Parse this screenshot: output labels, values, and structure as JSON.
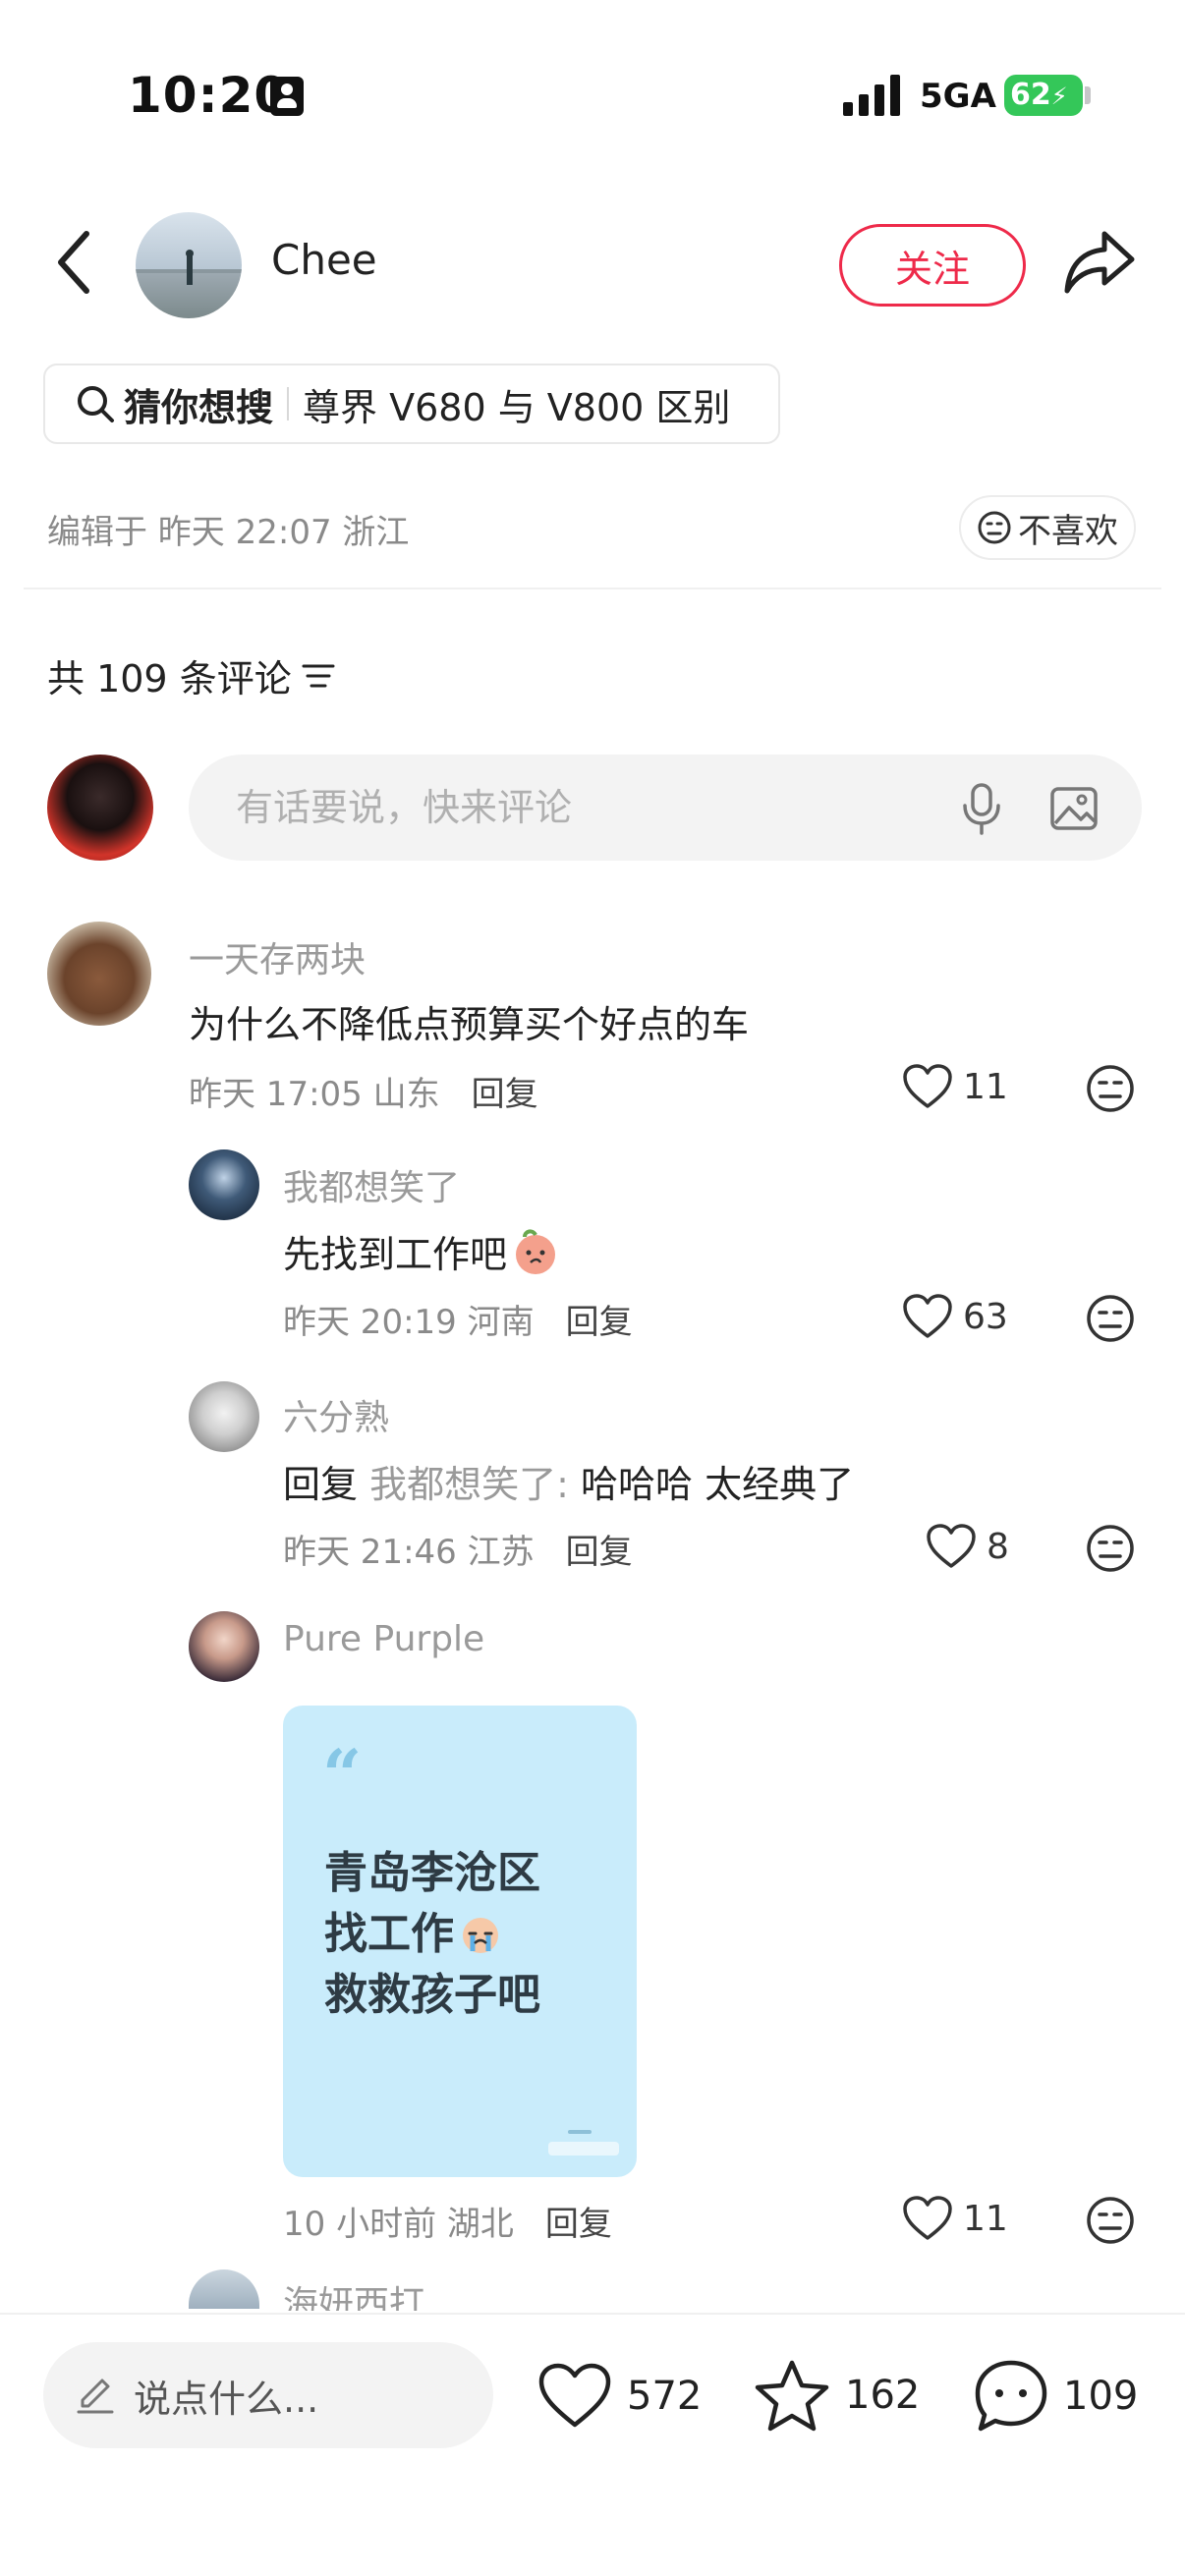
{
  "status_bar": {
    "time": "10:20",
    "network": "5GA",
    "battery": "62"
  },
  "header": {
    "username": "Chee",
    "follow_label": "关注"
  },
  "search_chip": {
    "prefix": "猜你想搜",
    "query": "尊界 V680 与 V800 区别"
  },
  "post_meta": {
    "edited": "编辑于 昨天 22:07 浙江",
    "dislike_label": "不喜欢"
  },
  "comments_header": {
    "count_label": "共 109 条评论"
  },
  "comment_input": {
    "placeholder": "有话要说，快来评论"
  },
  "comments": [
    {
      "nickname": "一天存两块",
      "text": "为什么不降低点预算买个好点的车",
      "time_location": "昨天 17:05 山东",
      "reply_label": "回复",
      "likes": "11"
    }
  ],
  "replies": [
    {
      "nickname": "我都想笑了",
      "text": "先找到工作吧",
      "time_location": "昨天 20:19 河南",
      "reply_label": "回复",
      "likes": "63"
    },
    {
      "nickname": "六分熟",
      "reply_prefix": "回复",
      "reply_to": "我都想笑了:",
      "text": "哈哈哈  太经典了",
      "time_location": "昨天 21:46 江苏",
      "reply_label": "回复",
      "likes": "8"
    },
    {
      "nickname": "Pure Purple",
      "card_lines": [
        "青岛李沧区",
        "找工作",
        "救救孩子吧"
      ],
      "time_location": "10 小时前 湖北",
      "reply_label": "回复",
      "likes": "11"
    },
    {
      "nickname": "海妍西打"
    }
  ],
  "bottom_bar": {
    "input_placeholder": "说点什么...",
    "likes": "572",
    "stars": "162",
    "comments": "109"
  },
  "colors": {
    "accent": "#ee2a4a",
    "battery": "#34c759",
    "card_bg": "#c9ecfb"
  }
}
